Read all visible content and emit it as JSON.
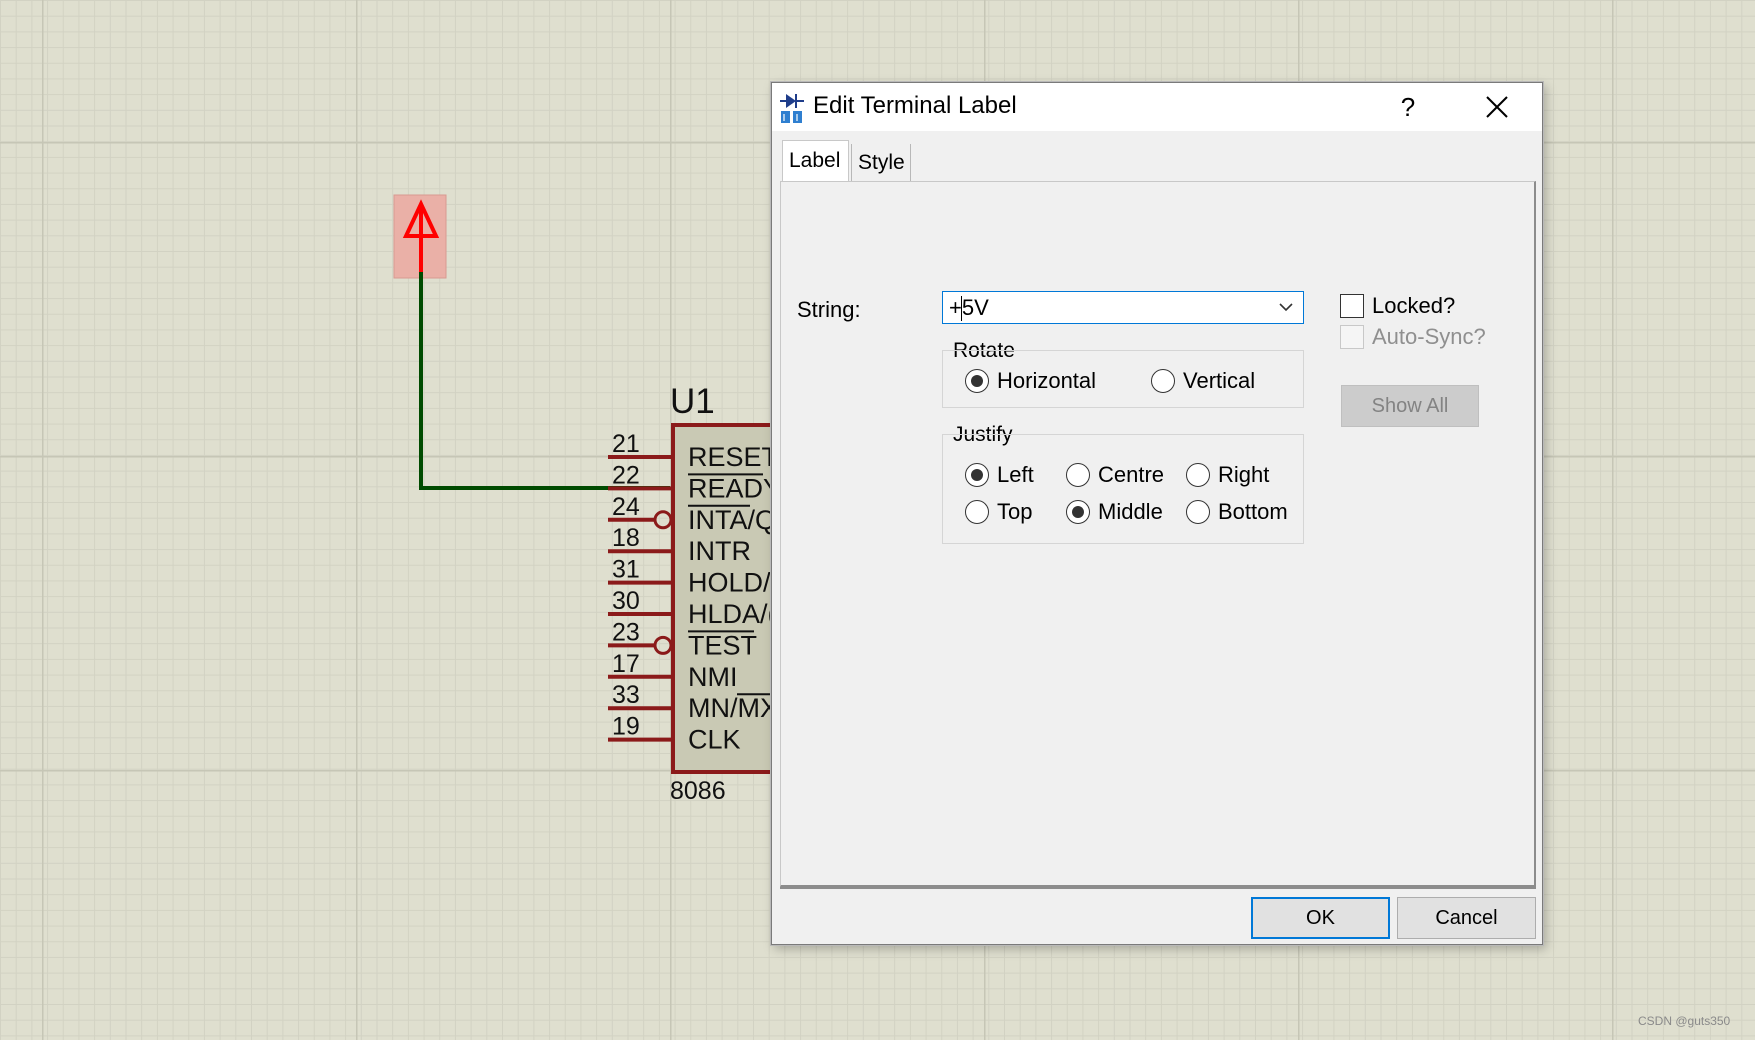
{
  "schematic": {
    "component_ref": "U1",
    "component_value": "8086",
    "pins": [
      {
        "number": "21",
        "name": "RESET"
      },
      {
        "number": "22",
        "name": "READY"
      },
      {
        "number": "24",
        "name": "INTA/Q"
      },
      {
        "number": "18",
        "name": "INTR"
      },
      {
        "number": "31",
        "name": "HOLD/"
      },
      {
        "number": "30",
        "name": "HLDA/("
      },
      {
        "number": "23",
        "name": "TEST"
      },
      {
        "number": "17",
        "name": "NMI"
      },
      {
        "number": "33",
        "name": "MN/MX"
      },
      {
        "number": "19",
        "name": "CLK"
      }
    ],
    "colors": {
      "wire": "#004b00",
      "body_border": "#8b1a1a",
      "body_fill": "#c9c9b4",
      "terminal": "#ff0000",
      "terminal_highlight": "#eab0a7"
    }
  },
  "dialog": {
    "title": "Edit Terminal Label",
    "help": "?",
    "tabs": [
      {
        "label": "Label"
      },
      {
        "label": "Style"
      }
    ],
    "string_label": "String:",
    "string_value": "+5V",
    "rotate": {
      "title": "Rotate",
      "options": [
        {
          "label": "Horizontal",
          "selected": true
        },
        {
          "label": "Vertical",
          "selected": false
        }
      ]
    },
    "justify": {
      "title": "Justify",
      "options": [
        {
          "label": "Left",
          "selected": true
        },
        {
          "label": "Centre",
          "selected": false
        },
        {
          "label": "Right",
          "selected": false
        },
        {
          "label": "Top",
          "selected": false
        },
        {
          "label": "Middle",
          "selected": true
        },
        {
          "label": "Bottom",
          "selected": false
        }
      ]
    },
    "locked_label": "Locked?",
    "autosync_label": "Auto-Sync?",
    "show_all_label": "Show All",
    "ok_label": "OK",
    "cancel_label": "Cancel"
  },
  "watermark": "CSDN @guts350"
}
